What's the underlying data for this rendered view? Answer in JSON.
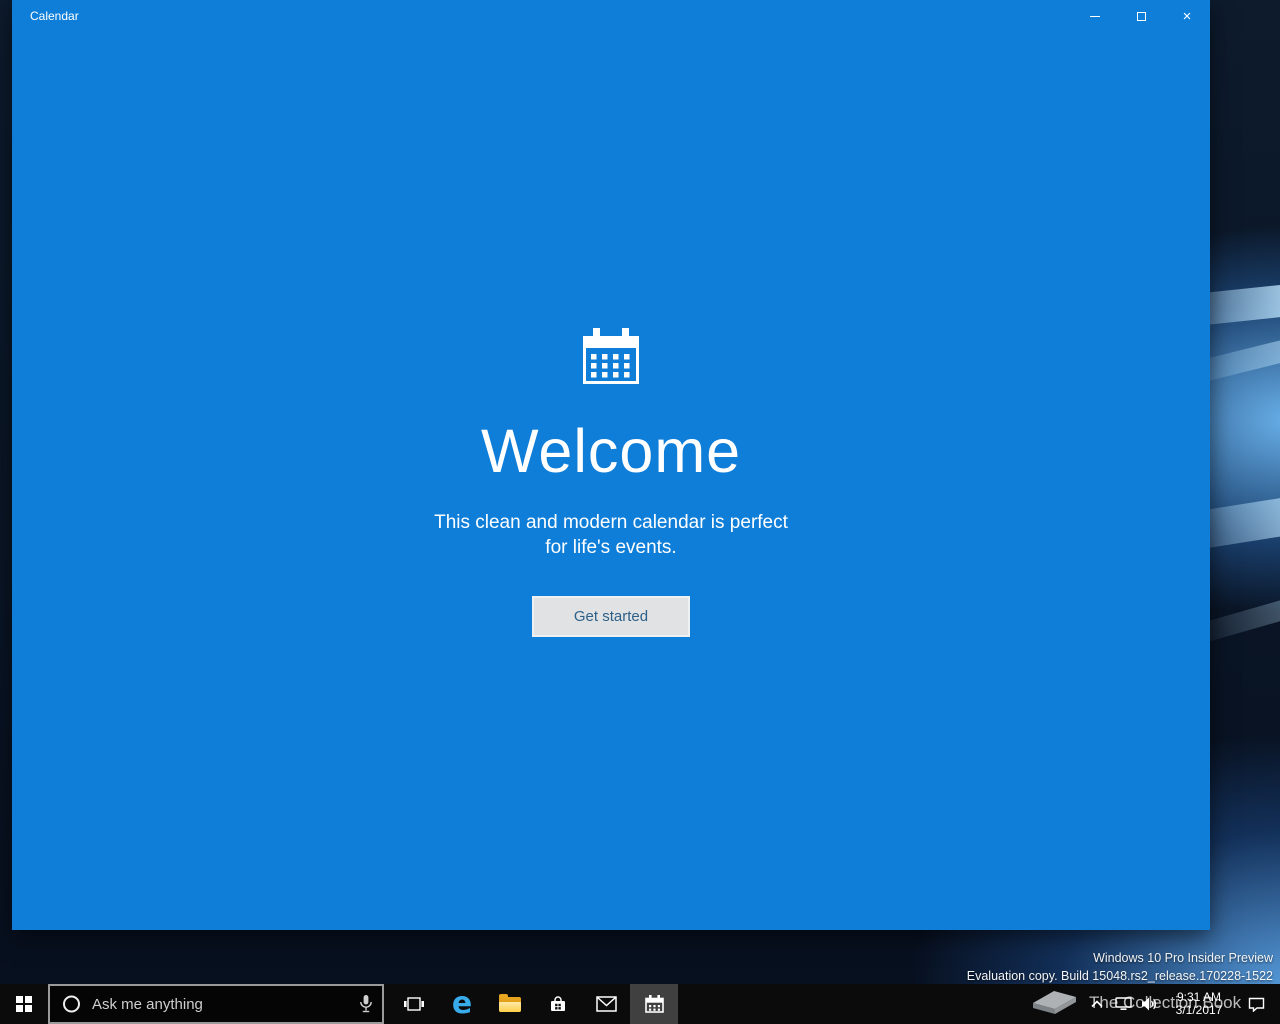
{
  "window": {
    "title": "Calendar"
  },
  "welcome": {
    "title": "Welcome",
    "subtitle_line1": "This clean and modern calendar is perfect",
    "subtitle_line2": "for life's events.",
    "button_label": "Get started"
  },
  "desktop": {
    "eval_line1": "Windows 10 Pro Insider Preview",
    "eval_line2": "Evaluation copy. Build 15048.rs2_release.170228-1522",
    "brand_watermark": "The Collection Book"
  },
  "taskbar": {
    "search_placeholder": "Ask me anything",
    "clock": {
      "time": "9:31 AM",
      "date": "3/1/2017"
    }
  },
  "icons": {
    "minimize": "–",
    "close": "×",
    "edge": "e"
  },
  "colors": {
    "accent_blue": "#0f7ed9",
    "taskbar_black": "#0b0b0b",
    "button_bg": "#e0e2e3",
    "button_text": "#2d5f87",
    "wallpaper_glow": "#4da0e8"
  }
}
